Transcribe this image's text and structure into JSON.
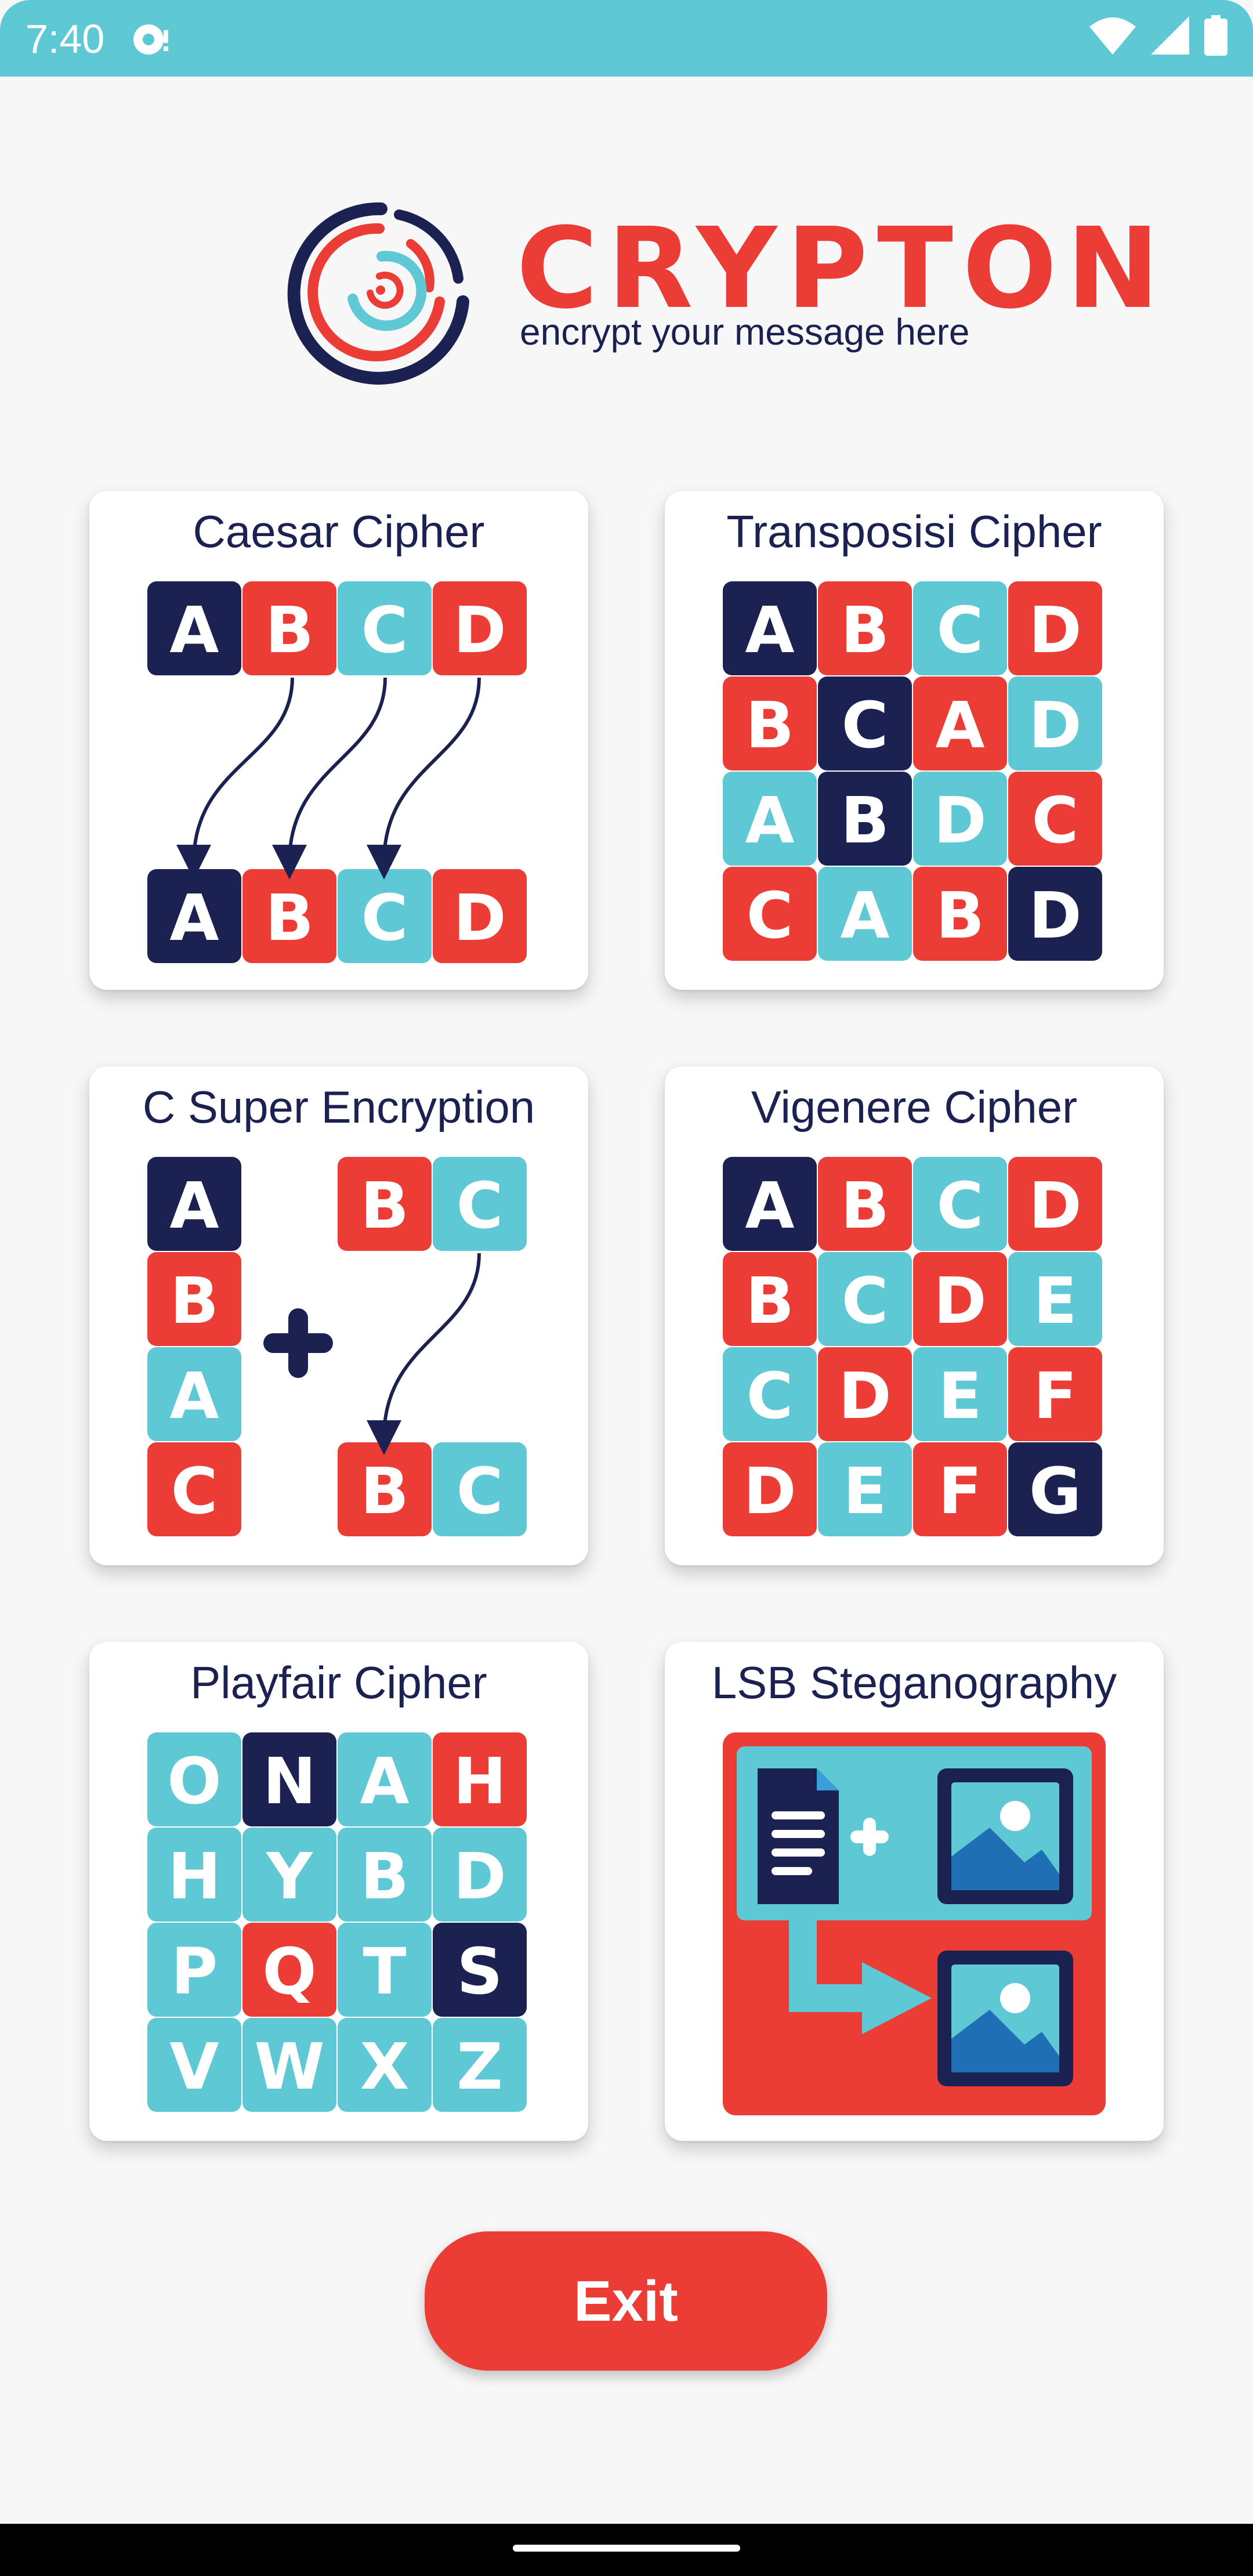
{
  "status_bar": {
    "time": "7:40"
  },
  "header": {
    "brand": "CRYPTON",
    "tagline": "encrypt your message here"
  },
  "colors": {
    "navy": "#1b2150",
    "red": "#ec3c36",
    "cyan": "#5fc8d5",
    "accent": "#5fc8d5"
  },
  "cards": [
    {
      "title": "Caesar Cipher",
      "icon": "caesar-shift-icon",
      "top_row": [
        "A",
        "B",
        "C",
        "D"
      ],
      "bottom_row": [
        "A",
        "B",
        "C",
        "D"
      ]
    },
    {
      "title": "Transposisi Cipher",
      "icon": "transposition-grid-icon",
      "grid": [
        [
          "A",
          "B",
          "C",
          "D"
        ],
        [
          "B",
          "C",
          "A",
          "D"
        ],
        [
          "A",
          "B",
          "D",
          "C"
        ],
        [
          "C",
          "A",
          "B",
          "D"
        ]
      ]
    },
    {
      "title": "C Super Encryption",
      "icon": "super-encryption-icon",
      "column": [
        "A",
        "B",
        "A",
        "C"
      ],
      "top_pair": [
        "B",
        "C"
      ],
      "bottom_pair": [
        "B",
        "C"
      ]
    },
    {
      "title": "Vigenere Cipher",
      "icon": "vigenere-table-icon",
      "grid": [
        [
          "A",
          "B",
          "C",
          "D"
        ],
        [
          "B",
          "C",
          "D",
          "E"
        ],
        [
          "C",
          "D",
          "E",
          "F"
        ],
        [
          "D",
          "E",
          "F",
          "G"
        ]
      ]
    },
    {
      "title": "Playfair Cipher",
      "icon": "playfair-grid-icon",
      "grid": [
        [
          "O",
          "N",
          "A",
          "H"
        ],
        [
          "H",
          "Y",
          "B",
          "D"
        ],
        [
          "P",
          "Q",
          "T",
          "S"
        ],
        [
          "V",
          "W",
          "X",
          "Z"
        ]
      ]
    },
    {
      "title": "LSB Steganography",
      "icon": "steganography-icon"
    }
  ],
  "exit_button": {
    "label": "Exit"
  }
}
